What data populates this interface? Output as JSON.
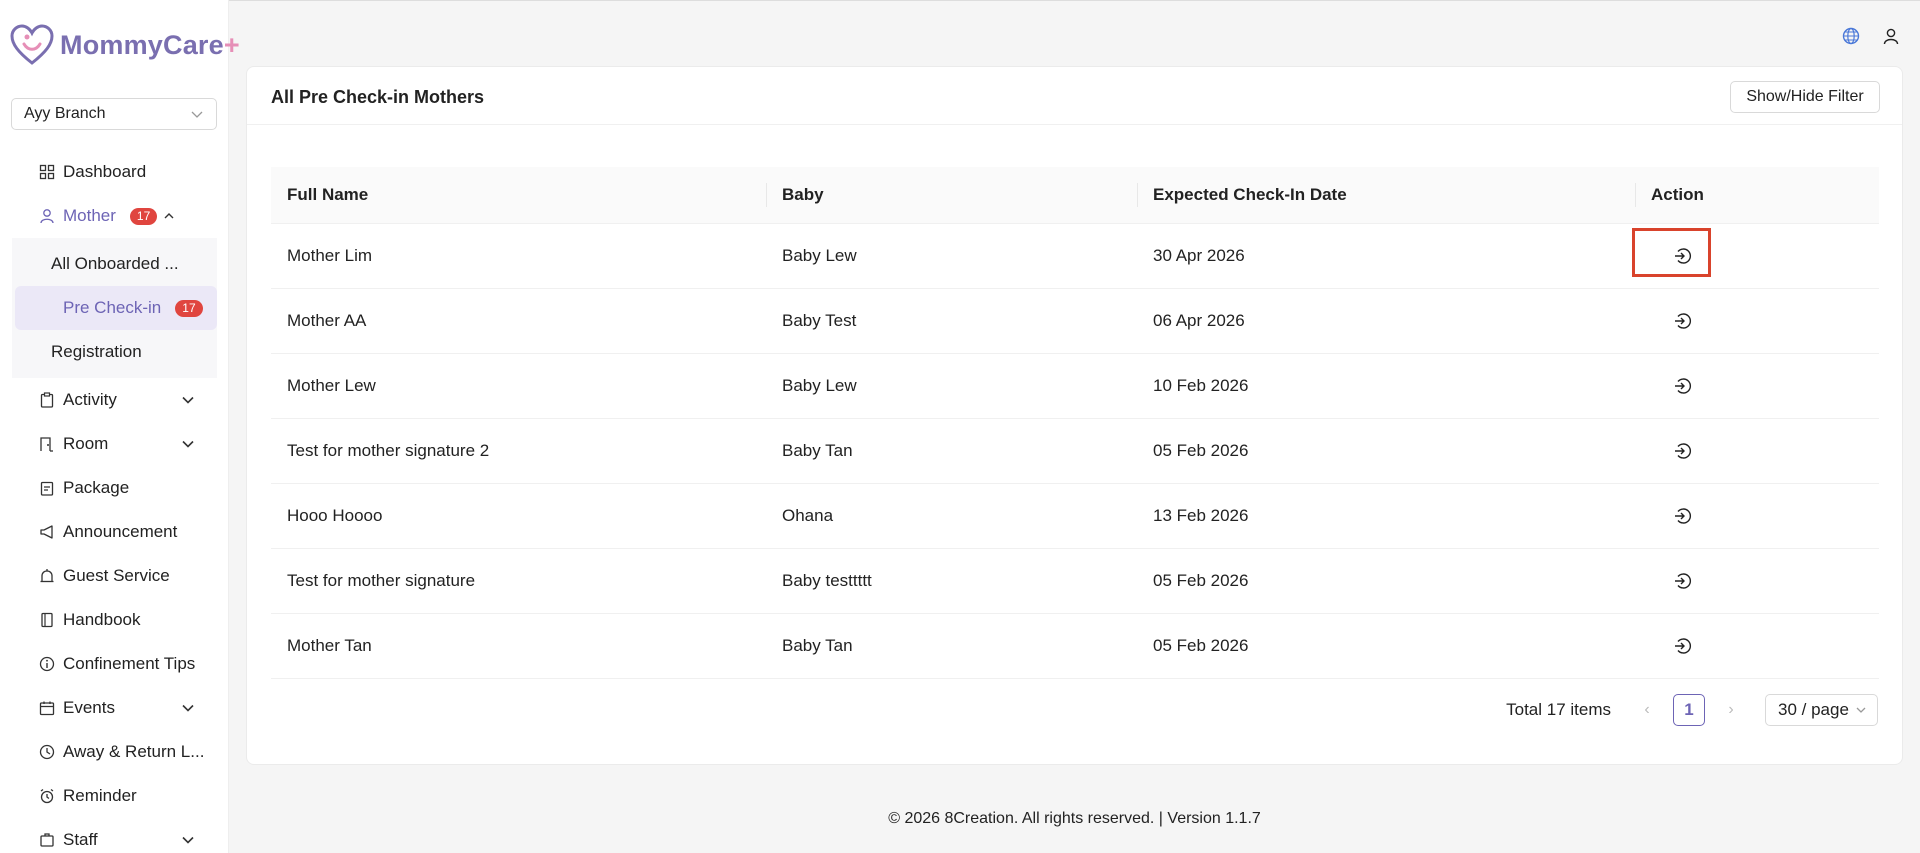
{
  "brand": {
    "name": "MommyCare",
    "plus": "+"
  },
  "branch": {
    "selected": "Ayy Branch"
  },
  "sidebar": {
    "items": [
      {
        "label": "Dashboard",
        "icon": "dashboard-icon"
      },
      {
        "label": "Mother",
        "icon": "user-icon",
        "badge": "17"
      },
      {
        "label": "Activity",
        "icon": "clipboard-icon"
      },
      {
        "label": "Room",
        "icon": "room-icon"
      },
      {
        "label": "Package",
        "icon": "package-icon"
      },
      {
        "label": "Announcement",
        "icon": "megaphone-icon"
      },
      {
        "label": "Guest Service",
        "icon": "bell-icon"
      },
      {
        "label": "Handbook",
        "icon": "book-icon"
      },
      {
        "label": "Confinement Tips",
        "icon": "info-icon"
      },
      {
        "label": "Events",
        "icon": "calendar-icon"
      },
      {
        "label": "Away & Return L...",
        "icon": "clock-icon"
      },
      {
        "label": "Reminder",
        "icon": "alarm-icon"
      },
      {
        "label": "Staff",
        "icon": "staff-icon"
      }
    ],
    "mother_sub": [
      {
        "label": "All Onboarded ..."
      },
      {
        "label": "Pre Check-in",
        "badge": "17"
      },
      {
        "label": "Registration"
      }
    ]
  },
  "card": {
    "title": "All Pre Check-in Mothers",
    "filter_button": "Show/Hide Filter"
  },
  "table": {
    "headers": [
      "Full Name",
      "Baby",
      "Expected Check-In Date",
      "Action"
    ],
    "rows": [
      [
        "Mother Lim",
        "Baby Lew",
        "30 Apr 2026"
      ],
      [
        "Mother AA",
        "Baby Test",
        "06 Apr 2026"
      ],
      [
        "Mother Lew",
        "Baby Lew",
        "10 Feb 2026"
      ],
      [
        "Test for mother signature 2",
        "Baby Tan",
        "05 Feb 2026"
      ],
      [
        "Hooo Hoooo",
        "Ohana",
        "13 Feb 2026"
      ],
      [
        "Test for mother signature",
        "Baby testtttt",
        "05 Feb 2026"
      ],
      [
        "Mother Tan",
        "Baby Tan",
        "05 Feb 2026"
      ]
    ]
  },
  "pagination": {
    "total": "Total 17 items",
    "current_page": "1",
    "page_size": "30 / page"
  },
  "footer": {
    "text": "© 2026 8Creation. All rights reserved. | Version 1.1.7"
  },
  "colors": {
    "accent": "#6d64b5",
    "badge": "#e0453f",
    "highlight": "#d9432c"
  }
}
